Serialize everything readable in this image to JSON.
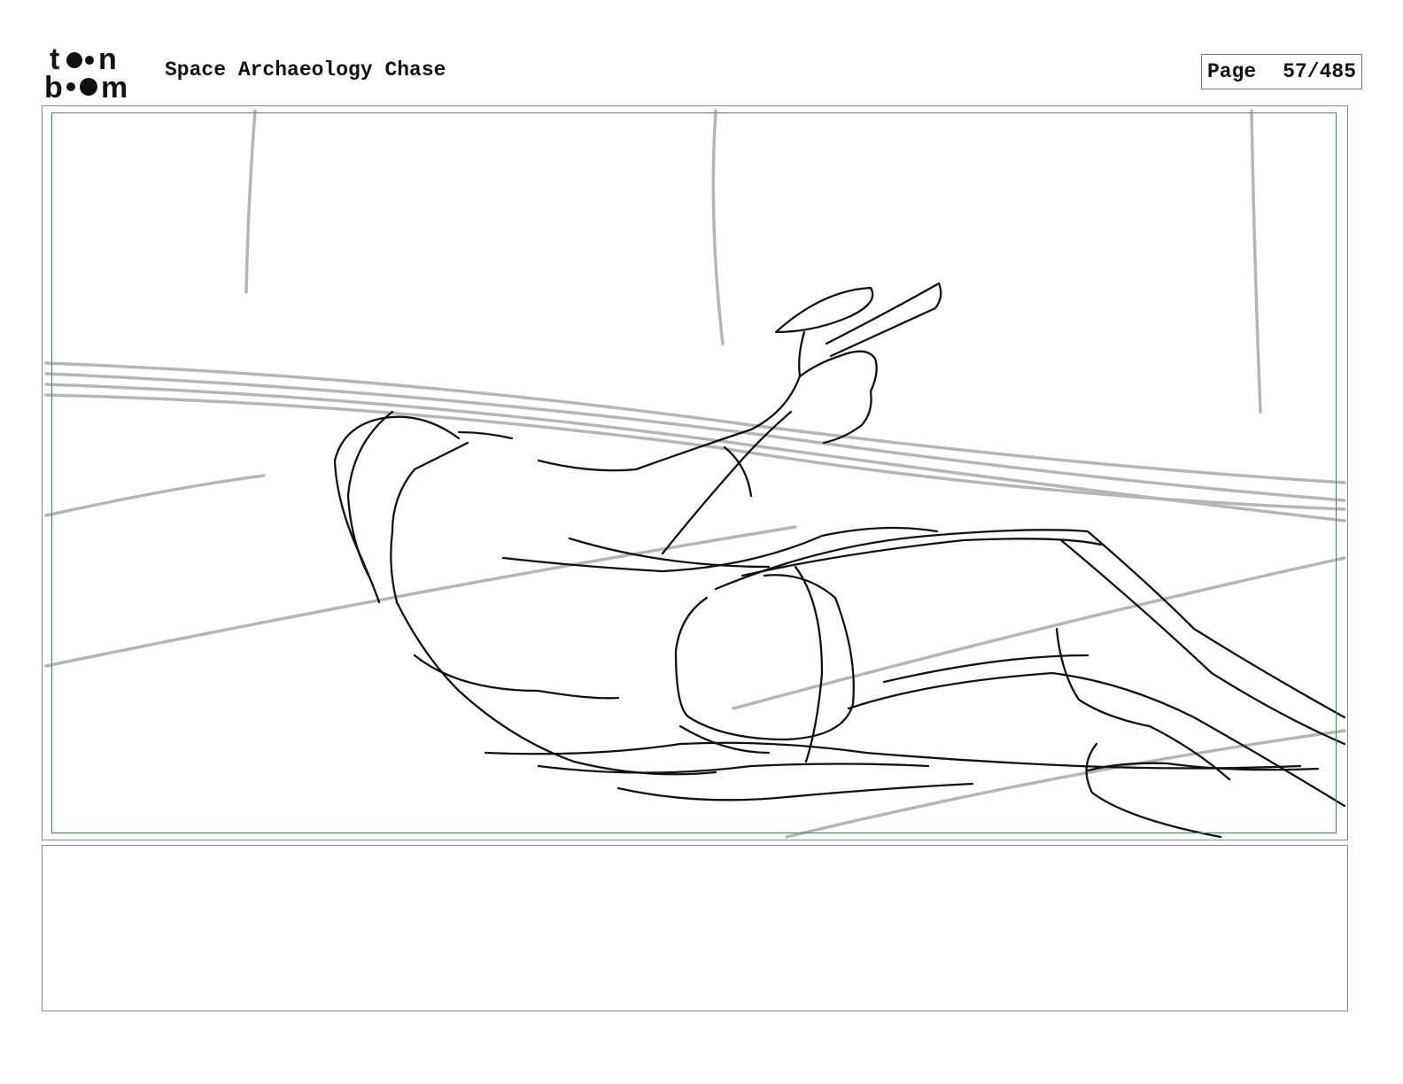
{
  "header": {
    "logo_text_top": "toon",
    "logo_text_bottom": "boom",
    "title": "Space Archaeology Chase",
    "page_label": "Page",
    "page_number": "57/485"
  },
  "panel": {
    "sketch_subject": "rough pencil sketch of a figure lying back on the floor, aiming a raygun"
  },
  "caption": {
    "text": ""
  }
}
